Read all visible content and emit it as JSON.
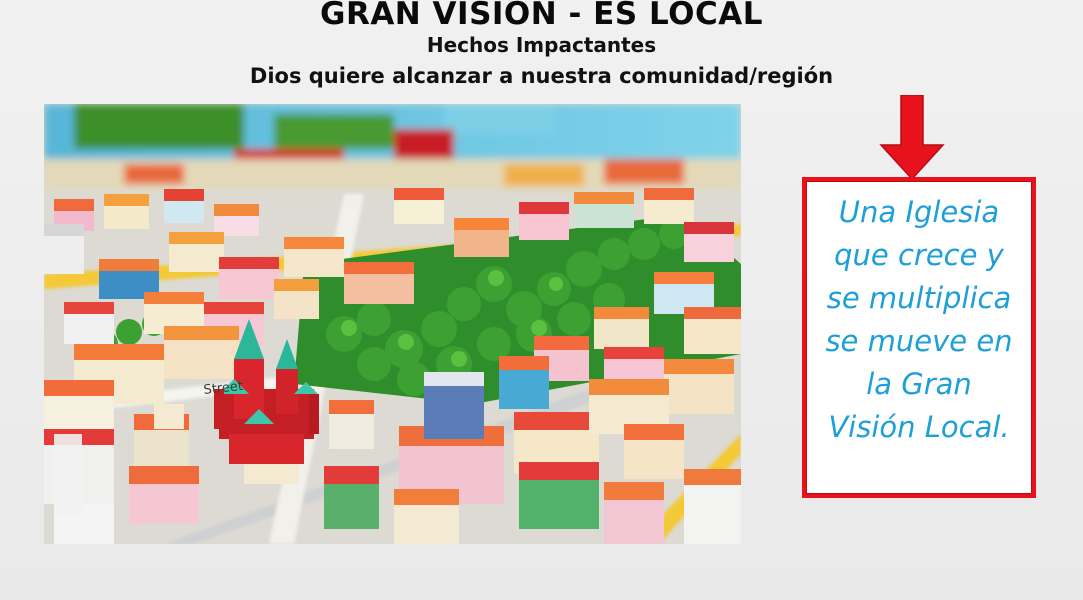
{
  "slide": {
    "title": "GRAN VISIÓN - ES LOCAL",
    "subtitle_1": "Hechos Impactantes",
    "subtitle_2": "Dios quiere alcanzar a nuestra comunidad/región",
    "callout_text": "Una Iglesia\nque  crece y\nse multiplica\nse mueve en\nla Gran\nVisión Local.",
    "image_street_label": "Street",
    "colors": {
      "accent_red": "#e8121d",
      "callout_text": "#1f9fd8",
      "title": "#0a0a0a"
    }
  }
}
